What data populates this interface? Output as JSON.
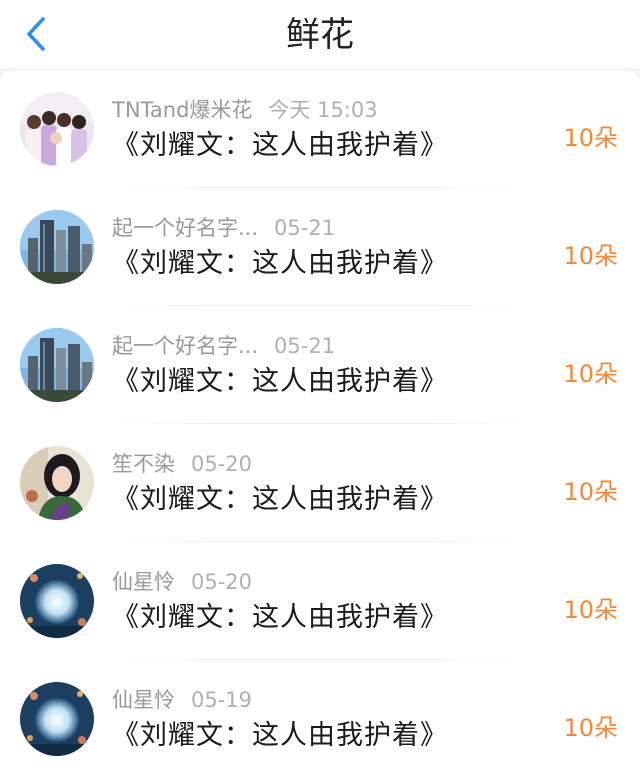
{
  "header": {
    "title": "鲜花"
  },
  "colors": {
    "accent": "#2f8cf0",
    "count": "#ef8a3a"
  },
  "items": [
    {
      "user": "TNTand爆米花",
      "time": "今天 15:03",
      "message": "《刘耀文：这人由我护着》",
      "count": "10朵",
      "avatar": "group-photo"
    },
    {
      "user": "起一个好名字...",
      "time": "05-21",
      "message": "《刘耀文：这人由我护着》",
      "count": "10朵",
      "avatar": "city-skyline"
    },
    {
      "user": "起一个好名字...",
      "time": "05-21",
      "message": "《刘耀文：这人由我护着》",
      "count": "10朵",
      "avatar": "city-skyline"
    },
    {
      "user": "笙不染",
      "time": "05-20",
      "message": "《刘耀文：这人由我护着》",
      "count": "10朵",
      "avatar": "portrait"
    },
    {
      "user": "仙星怜",
      "time": "05-20",
      "message": "《刘耀文：这人由我护着》",
      "count": "10朵",
      "avatar": "moon-night"
    },
    {
      "user": "仙星怜",
      "time": "05-19",
      "message": "《刘耀文：这人由我护着》",
      "count": "10朵",
      "avatar": "moon-night"
    }
  ]
}
